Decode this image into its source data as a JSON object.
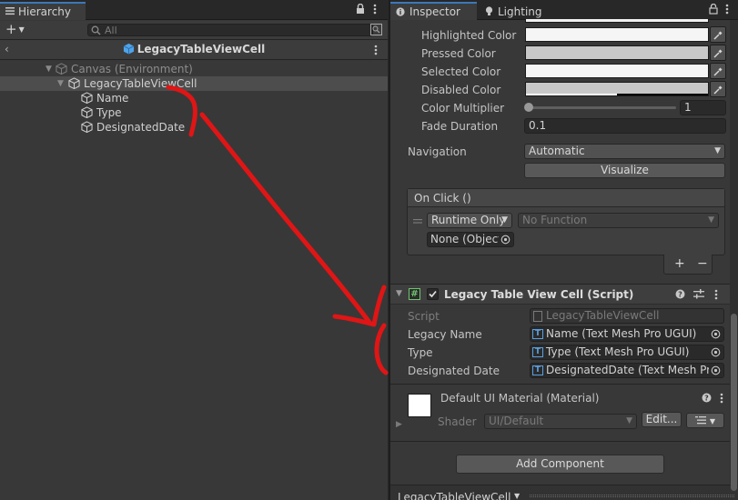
{
  "hierarchy": {
    "tab_label": "Hierarchy",
    "search_placeholder": "All",
    "scene_title": "LegacyTableViewCell",
    "tree": [
      {
        "label": "Canvas (Environment)",
        "dim": true
      },
      {
        "label": "LegacyTableViewCell",
        "selected": true
      },
      {
        "label": "Name"
      },
      {
        "label": "Type"
      },
      {
        "label": "DesignatedDate"
      }
    ]
  },
  "inspector": {
    "tabs": [
      {
        "label": "Inspector",
        "icon": "info-icon"
      },
      {
        "label": "Lighting",
        "icon": "lightbulb-icon"
      }
    ],
    "colors": [
      {
        "label": "Highlighted Color",
        "value": "#F5F5F5"
      },
      {
        "label": "Pressed Color",
        "value": "#C8C8C8"
      },
      {
        "label": "Selected Color",
        "value": "#F5F5F5"
      },
      {
        "label": "Disabled Color",
        "value": "#C8C8C8"
      }
    ],
    "color_multiplier": {
      "label": "Color Multiplier",
      "value": "1"
    },
    "fade_duration": {
      "label": "Fade Duration",
      "value": "0.1"
    },
    "navigation": {
      "label": "Navigation",
      "value": "Automatic"
    },
    "visualize_label": "Visualize",
    "on_click": {
      "header": "On Click ()",
      "runtime": "Runtime Only",
      "function": "No Function",
      "object": "None (Object",
      "add": "+",
      "remove": "−"
    },
    "script_component": {
      "title": "Legacy Table View Cell (Script)",
      "fields": [
        {
          "label": "Script",
          "value": "LegacyTableViewCell",
          "dim": true
        },
        {
          "label": "Legacy Name",
          "value": "Name (Text Mesh Pro UGUI)"
        },
        {
          "label": "Type",
          "value": "Type (Text Mesh Pro UGUI)"
        },
        {
          "label": "Designated Date",
          "value": "DesignatedDate (Text Mesh Pro"
        }
      ]
    },
    "material": {
      "title": "Default UI Material (Material)",
      "shader_label": "Shader",
      "shader_value": "UI/Default",
      "edit_label": "Edit..."
    },
    "add_component_label": "Add Component",
    "bottom_label": "LegacyTableViewCell"
  },
  "annotation_color": "#E01515"
}
